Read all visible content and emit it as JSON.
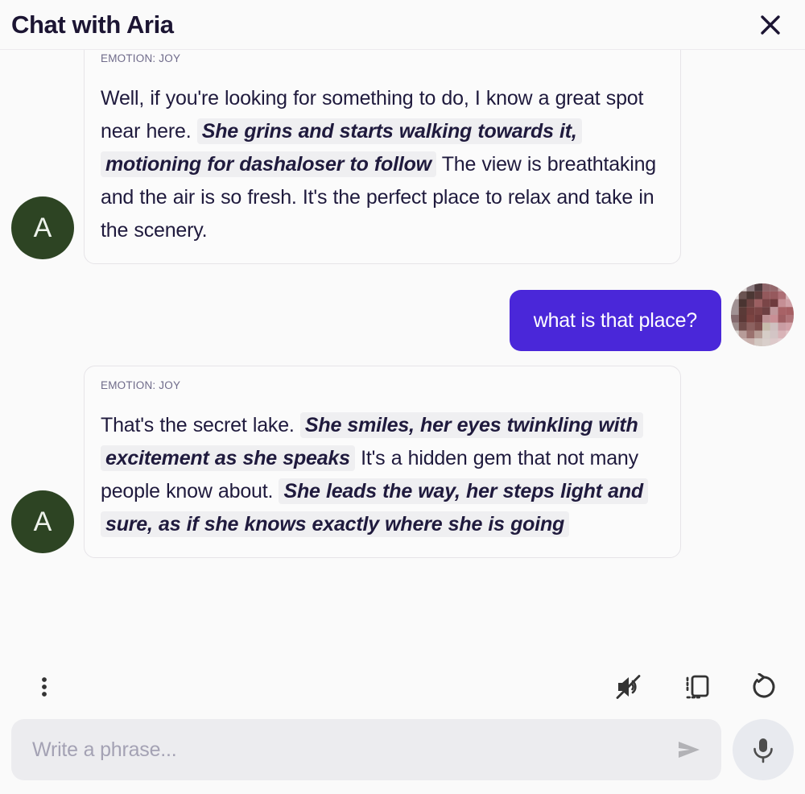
{
  "header": {
    "title": "Chat with Aria",
    "close_label": "close-icon"
  },
  "conversation": {
    "messages": [
      {
        "role": "assistant",
        "avatar_letter": "A",
        "emotion": "EMOTION: JOY",
        "segments": [
          {
            "type": "plain",
            "text": "Well, if you're looking for something to do, I know a great spot near here. "
          },
          {
            "type": "action",
            "text": "She grins and starts walking towards it, motioning for dashaloser to follow"
          },
          {
            "type": "plain",
            "text": " The view is breathtaking and the air is so fresh. It's the perfect place to relax and take in the scenery."
          }
        ]
      },
      {
        "role": "user",
        "text": "what is that place?"
      },
      {
        "role": "assistant",
        "avatar_letter": "A",
        "emotion": "EMOTION: JOY",
        "segments": [
          {
            "type": "plain",
            "text": "That's the secret lake. "
          },
          {
            "type": "action",
            "text": "She smiles, her eyes twinkling with excitement as she speaks"
          },
          {
            "type": "plain",
            "text": " It's a hidden gem that not many people know about. "
          },
          {
            "type": "action",
            "text": "She leads the way, her steps light and sure, as if she knows exactly where she is going"
          }
        ]
      }
    ]
  },
  "toolbar": {
    "more_label": "more-options-icon",
    "mute_label": "volume-muted-icon",
    "copy_label": "copy-icon",
    "regenerate_label": "regenerate-icon"
  },
  "composer": {
    "placeholder": "Write a phrase...",
    "value": "",
    "send_label": "send-icon",
    "mic_label": "microphone-icon"
  },
  "colors": {
    "user_bubble": "#4a27d9",
    "assistant_avatar": "#2d4423",
    "page_background": "#fafafa",
    "action_highlight": "#efeff1",
    "text_primary": "#1f1a3d",
    "emotion_text": "#6f6b8a",
    "input_background": "#ececef",
    "mic_background": "#e8eaef"
  }
}
